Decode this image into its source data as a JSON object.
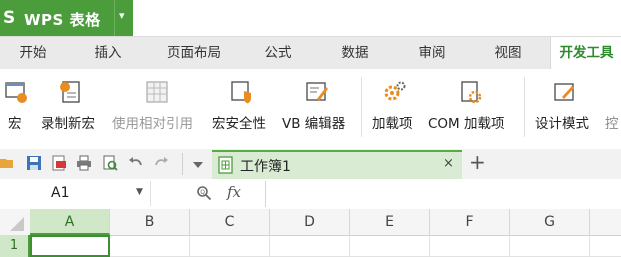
{
  "app": {
    "logo": "S",
    "name": "WPS 表格",
    "menu_caret": "▾"
  },
  "tabs": [
    {
      "label": "开始",
      "active": false
    },
    {
      "label": "插入",
      "active": false
    },
    {
      "label": "页面布局",
      "active": false
    },
    {
      "label": "公式",
      "active": false
    },
    {
      "label": "数据",
      "active": false
    },
    {
      "label": "审阅",
      "active": false
    },
    {
      "label": "视图",
      "active": false
    },
    {
      "label": "开发工具",
      "active": true
    }
  ],
  "ribbon": {
    "macro": "宏",
    "record_macro": "录制新宏",
    "relative_ref": "使用相对引用",
    "macro_security": "宏安全性",
    "vb_editor": "VB 编辑器",
    "addins": "加载项",
    "com_addins": "COM 加载项",
    "design_mode": "设计模式",
    "controls": "控"
  },
  "doc_tab": {
    "title": "工作簿1",
    "close": "×",
    "add": "+"
  },
  "formula_bar": {
    "name_box": "A1",
    "fx": "fx",
    "value": ""
  },
  "grid": {
    "columns": [
      "A",
      "B",
      "C",
      "D",
      "E",
      "F",
      "G"
    ],
    "rows": [
      "1"
    ],
    "selected_column": "A",
    "active_cell": "A1"
  },
  "colors": {
    "accent": "#4a9d3a",
    "active_tab_text": "#2e8a2e",
    "selection_fill": "#d0e8c7"
  }
}
